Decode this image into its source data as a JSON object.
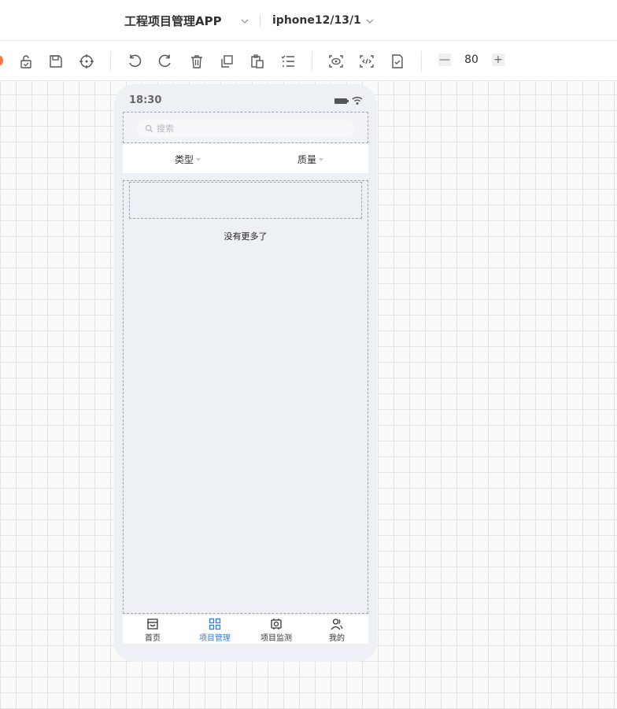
{
  "header": {
    "project_title": "工程项目管理APP",
    "device_name": "iphone12/13/1"
  },
  "toolbar": {
    "icons": [
      "lock-icon",
      "save-icon",
      "target-icon",
      "undo-icon",
      "redo-icon",
      "delete-icon",
      "copy-icon",
      "paste-icon",
      "list-icon",
      "preview-icon",
      "code-icon",
      "check-doc-icon"
    ],
    "zoom": {
      "minus": "—",
      "value": "80",
      "plus": "+"
    }
  },
  "phone": {
    "status_time": "18:30",
    "search": {
      "placeholder": "搜索"
    },
    "filters": [
      {
        "label": "类型"
      },
      {
        "label": "质量"
      }
    ],
    "list": {
      "empty_text": "没有更多了"
    },
    "tabs": [
      {
        "label": "首页",
        "icon": "store-icon",
        "active": false
      },
      {
        "label": "项目管理",
        "icon": "grid-icon",
        "active": true
      },
      {
        "label": "项目监测",
        "icon": "monitor-icon",
        "active": false
      },
      {
        "label": "我的",
        "icon": "users-icon",
        "active": false
      }
    ]
  },
  "colors": {
    "accent": "#2f7be6",
    "orange": "#f2784b"
  }
}
